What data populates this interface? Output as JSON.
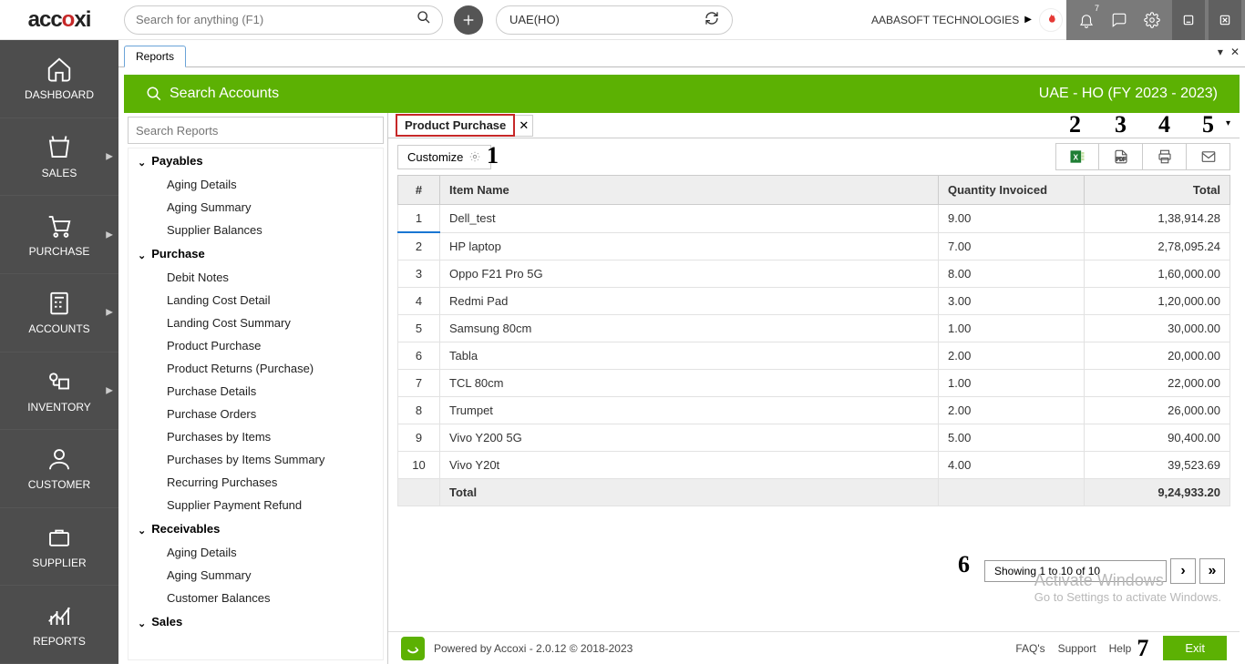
{
  "top": {
    "logo_part1": "acc",
    "logo_part2": "o",
    "logo_part3": "xi",
    "search_placeholder": "Search for anything (F1)",
    "company": "UAE(HO)",
    "org": "AABASOFT TECHNOLOGIES",
    "bell_badge": "7"
  },
  "rail": [
    {
      "label": "DASHBOARD"
    },
    {
      "label": "SALES",
      "chev": true
    },
    {
      "label": "PURCHASE",
      "chev": true
    },
    {
      "label": "ACCOUNTS",
      "chev": true
    },
    {
      "label": "INVENTORY",
      "chev": true
    },
    {
      "label": "CUSTOMER"
    },
    {
      "label": "SUPPLIER"
    },
    {
      "label": "REPORTS"
    }
  ],
  "tab": {
    "label": "Reports"
  },
  "greenbar": {
    "left": "Search Accounts",
    "right": "UAE - HO (FY 2023 - 2023)"
  },
  "reports_search_placeholder": "Search Reports",
  "tree": [
    {
      "type": "hdr",
      "label": "Payables"
    },
    {
      "type": "leaf",
      "label": "Aging Details"
    },
    {
      "type": "leaf",
      "label": "Aging Summary"
    },
    {
      "type": "leaf",
      "label": "Supplier Balances"
    },
    {
      "type": "hdr",
      "label": "Purchase"
    },
    {
      "type": "leaf",
      "label": "Debit Notes"
    },
    {
      "type": "leaf",
      "label": "Landing Cost Detail"
    },
    {
      "type": "leaf",
      "label": "Landing Cost Summary"
    },
    {
      "type": "leaf",
      "label": "Product Purchase"
    },
    {
      "type": "leaf",
      "label": "Product Returns (Purchase)"
    },
    {
      "type": "leaf",
      "label": "Purchase Details"
    },
    {
      "type": "leaf",
      "label": "Purchase Orders"
    },
    {
      "type": "leaf",
      "label": "Purchases by Items"
    },
    {
      "type": "leaf",
      "label": "Purchases by Items Summary"
    },
    {
      "type": "leaf",
      "label": "Recurring Purchases"
    },
    {
      "type": "leaf",
      "label": "Supplier Payment Refund"
    },
    {
      "type": "hdr",
      "label": "Receivables"
    },
    {
      "type": "leaf",
      "label": "Aging Details"
    },
    {
      "type": "leaf",
      "label": "Aging Summary"
    },
    {
      "type": "leaf",
      "label": "Customer Balances"
    },
    {
      "type": "hdr",
      "label": "Sales"
    }
  ],
  "report_tab": "Product Purchase",
  "customize_label": "Customize",
  "columns": {
    "idx": "#",
    "name": "Item Name",
    "qty": "Quantity Invoiced",
    "total": "Total"
  },
  "rows": [
    {
      "idx": "1",
      "name": "Dell_test",
      "qty": "9.00",
      "total": "1,38,914.28"
    },
    {
      "idx": "2",
      "name": "HP laptop",
      "qty": "7.00",
      "total": "2,78,095.24"
    },
    {
      "idx": "3",
      "name": "Oppo F21 Pro 5G",
      "qty": "8.00",
      "total": "1,60,000.00"
    },
    {
      "idx": "4",
      "name": "Redmi Pad",
      "qty": "3.00",
      "total": "1,20,000.00"
    },
    {
      "idx": "5",
      "name": "Samsung 80cm",
      "qty": "1.00",
      "total": "30,000.00"
    },
    {
      "idx": "6",
      "name": "Tabla",
      "qty": "2.00",
      "total": "20,000.00"
    },
    {
      "idx": "7",
      "name": "TCL 80cm",
      "qty": "1.00",
      "total": "22,000.00"
    },
    {
      "idx": "8",
      "name": "Trumpet",
      "qty": "2.00",
      "total": "26,000.00"
    },
    {
      "idx": "9",
      "name": "Vivo Y200 5G",
      "qty": "5.00",
      "total": "90,400.00"
    },
    {
      "idx": "10",
      "name": "Vivo Y20t",
      "qty": "4.00",
      "total": "39,523.69"
    }
  ],
  "total_row": {
    "label": "Total",
    "amount": "9,24,933.20"
  },
  "pager": {
    "info": "Showing 1 to 10 of 10"
  },
  "watermark": {
    "line1": "Activate Windows",
    "line2": "Go to Settings to activate Windows."
  },
  "footer": {
    "powered": "Powered by Accoxi - 2.0.12 © 2018-2023",
    "faqs": "FAQ's",
    "support": "Support",
    "help": "Help",
    "exit": "Exit"
  },
  "annotations": {
    "a1": "1",
    "a2": "2",
    "a3": "3",
    "a4": "4",
    "a5": "5",
    "a6": "6",
    "a7": "7"
  }
}
